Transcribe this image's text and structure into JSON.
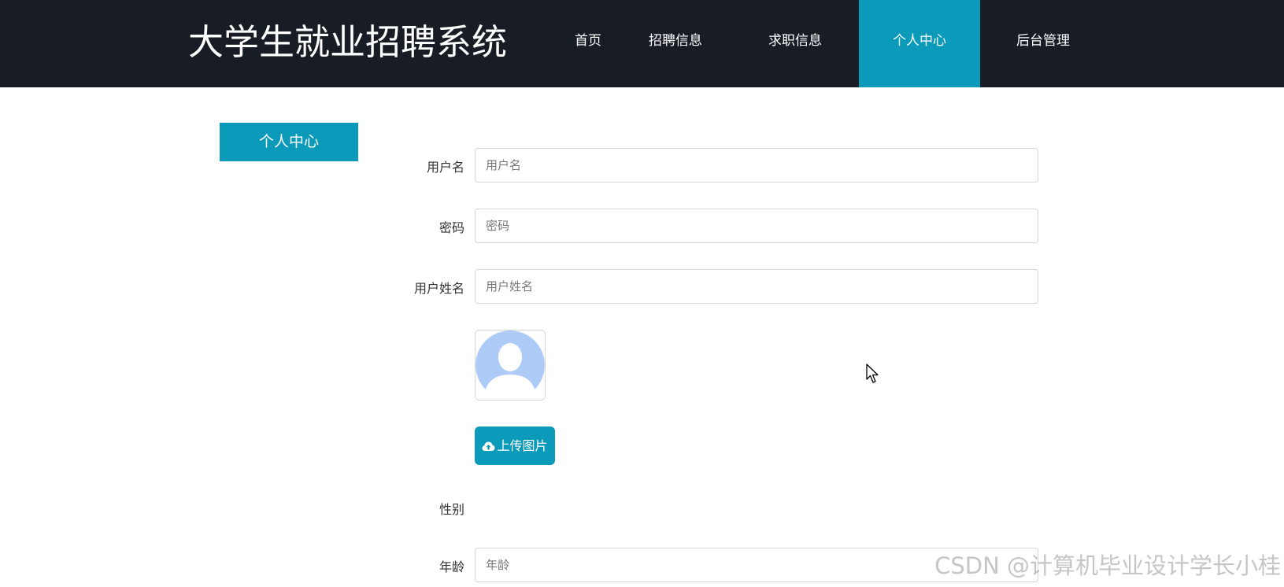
{
  "header": {
    "site_title": "大学生就业招聘系统",
    "nav": [
      {
        "label": "首页",
        "active": false
      },
      {
        "label": "招聘信息",
        "active": false
      },
      {
        "label": "求职信息",
        "active": false
      },
      {
        "label": "个人中心",
        "active": true
      },
      {
        "label": "后台管理",
        "active": false
      }
    ]
  },
  "sidebar": {
    "title": "个人中心"
  },
  "form": {
    "username": {
      "label": "用户名",
      "placeholder": "用户名",
      "value": ""
    },
    "password": {
      "label": "密码",
      "placeholder": "密码",
      "value": ""
    },
    "fullname": {
      "label": "用户姓名",
      "placeholder": "用户姓名",
      "value": ""
    },
    "avatar": {
      "icon": "user-avatar-icon"
    },
    "upload": {
      "label": "上传图片",
      "icon": "cloud-upload-icon"
    },
    "gender": {
      "label": "性别"
    },
    "age": {
      "label": "年龄",
      "placeholder": "年龄",
      "value": ""
    }
  },
  "watermark": "CSDN @计算机毕业设计学长小桂",
  "colors": {
    "header_bg": "#171c25",
    "accent": "#0b9ab9",
    "avatar": "#aecbf8"
  }
}
